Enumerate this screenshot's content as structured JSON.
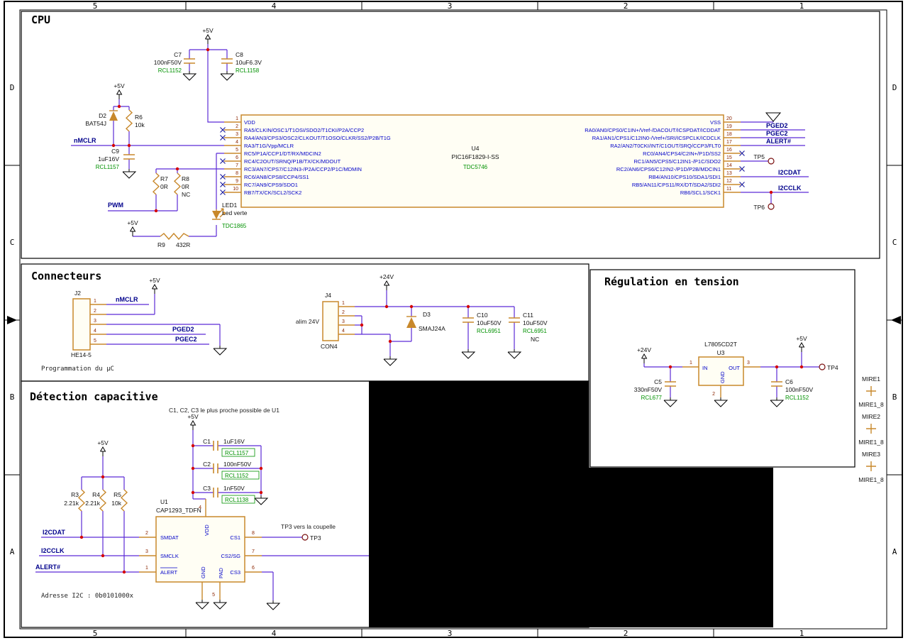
{
  "frame": {
    "columns": [
      "5",
      "4",
      "3",
      "2",
      "1"
    ],
    "rows": [
      "D",
      "C",
      "B",
      "A"
    ]
  },
  "power": {
    "p5v": "+5V",
    "p24v": "+24V"
  },
  "sections": {
    "cpu": {
      "title": "CPU"
    },
    "connecteurs": {
      "title": "Connecteurs"
    },
    "detection": {
      "title": "Détection capacitive"
    },
    "regulation": {
      "title": "Régulation en tension"
    }
  },
  "cpu": {
    "c7": {
      "ref": "C7",
      "value": "100nF50V",
      "code": "RCL1152"
    },
    "c8": {
      "ref": "C8",
      "value": "10uF6.3V",
      "code": "RCL1158"
    },
    "c9": {
      "ref": "C9",
      "value": "1uF16V",
      "code": "RCL1157"
    },
    "d2": {
      "ref": "D2",
      "value": "BAT54J"
    },
    "r6": {
      "ref": "R6",
      "value": "10k"
    },
    "r7": {
      "ref": "R7",
      "value": "0R"
    },
    "r8": {
      "ref": "R8",
      "value": "0R",
      "note": "NC"
    },
    "r9": {
      "ref": "R9",
      "value": "432R"
    },
    "led1": {
      "ref": "LED1",
      "value": "Led verte",
      "code": "TDC1865"
    },
    "u4": {
      "ref": "U4",
      "value": "PIC16F1829-I-SS",
      "code": "TDC5746",
      "left_pins": [
        {
          "num": "1",
          "name": "VDD"
        },
        {
          "num": "2",
          "name": "RA5/CLKIN/OSC1/T1OSI/SDO2/T1CKI/P2A/CCP2"
        },
        {
          "num": "3",
          "name": "RA4/AN3/CPS3/OSC2/CLKOUT/T1OSO/CLKR/SS2/P2B/T1G"
        },
        {
          "num": "4",
          "name": "RA3/T1G/Vpp/MCLR"
        },
        {
          "num": "5",
          "name": "RC5/P1A/CCP1/DT/RX/MDCIN2"
        },
        {
          "num": "6",
          "name": "RC4/C2OUT/SRNQ/P1B/TX/CK/MDOUT"
        },
        {
          "num": "7",
          "name": "RC3/AN7/CPS7/C12IN3-/P2A/CCP2/P1C/MDMIN"
        },
        {
          "num": "8",
          "name": "RC6/AN8/CPS8/CCP4/SS1"
        },
        {
          "num": "9",
          "name": "RC7/AN9/CPS9/SDO1"
        },
        {
          "num": "10",
          "name": "RB7/TX/CK/SCL2/SCK2"
        }
      ],
      "right_pins": [
        {
          "num": "20",
          "name": "VSS"
        },
        {
          "num": "19",
          "name": "RA0/AN0/CPS0/C1IN+/Vref-/DACOUT/ICSPDAT/ICDDAT"
        },
        {
          "num": "18",
          "name": "RA1/AN1/CPS1/C12IN0-/Vref+/SRI/ICSPCLK/ICDCLK"
        },
        {
          "num": "17",
          "name": "RA2/AN2/T0CKI/INT/C1OUT/SRQ/CCP3/FLT0"
        },
        {
          "num": "16",
          "name": "RC0/AN4/CPS4/C2IN+/P1D/SS2"
        },
        {
          "num": "15",
          "name": "RC1/AN5/CPS5/C12IN1-/P1C/SDO2"
        },
        {
          "num": "14",
          "name": "RC2/AN6/CPS6/C12IN2-/P1D/P2B/MDCIN1"
        },
        {
          "num": "13",
          "name": "RB4/AN10/CPS10/SDA1/SDI1"
        },
        {
          "num": "12",
          "name": "RB5/AN11/CPS11/RX/DT/SDA2/SDI2"
        },
        {
          "num": "11",
          "name": "RB6/SCL1/SCK1"
        }
      ]
    },
    "nets": {
      "nmclr": "nMCLR",
      "pwm": "PWM",
      "pged2": "PGED2",
      "pgec2": "PGEC2",
      "alert": "ALERT#",
      "i2cdat": "I2CDAT",
      "i2cclk": "I2CCLK"
    },
    "testpoints": {
      "tp5": "TP5",
      "tp6": "TP6"
    }
  },
  "connecteurs": {
    "j2": {
      "ref": "J2",
      "value": "HE14-5",
      "pins": [
        "1",
        "2",
        "3",
        "4",
        "5"
      ]
    },
    "caption": "Programmation du µC",
    "j4": {
      "ref": "J4",
      "value": "CON4",
      "pins": [
        "1",
        "2",
        "3",
        "4"
      ]
    },
    "alim": "alim 24V",
    "d3": {
      "ref": "D3",
      "value": "SMAJ24A"
    },
    "c10": {
      "ref": "C10",
      "value": "10uF50V",
      "code": "RCL6951"
    },
    "c11": {
      "ref": "C11",
      "value": "10uF50V",
      "code": "RCL6951",
      "note": "NC"
    },
    "nets": {
      "nmclr": "nMCLR",
      "pged2": "PGED2",
      "pgec2": "PGEC2"
    }
  },
  "regulation": {
    "u3": {
      "ref": "U3",
      "value": "L7805CD2T",
      "pin_in": "IN",
      "pin_out": "OUT",
      "pin_gnd": "GND",
      "num_in": "1",
      "num_gnd": "2",
      "num_out": "3"
    },
    "c5": {
      "ref": "C5",
      "value": "330nF50V",
      "code": "RCL677"
    },
    "c6": {
      "ref": "C6",
      "value": "100nF50V",
      "code": "RCL1152"
    },
    "tp4": "TP4",
    "mires": [
      {
        "name": "MIRE1",
        "fp": "MIRE1_8"
      },
      {
        "name": "MIRE2",
        "fp": "MIRE1_8"
      },
      {
        "name": "MIRE3",
        "fp": "MIRE1_8"
      }
    ]
  },
  "detection": {
    "note": "C1, C2, C3 le plus proche possible de U1",
    "c1": {
      "ref": "C1",
      "value": "1uF16V",
      "code": "RCL1157"
    },
    "c2": {
      "ref": "C2",
      "value": "100nF50V",
      "code": "RCL1152"
    },
    "c3": {
      "ref": "C3",
      "value": "1nF50V",
      "code": "RCL1138"
    },
    "r3": {
      "ref": "R3",
      "value": "2.21k"
    },
    "r4": {
      "ref": "R4",
      "value": "2.21k"
    },
    "r5": {
      "ref": "R5",
      "value": "10k"
    },
    "u1": {
      "ref": "U1",
      "value": "CAP1293_TDFN",
      "left_pins": [
        {
          "num": "2",
          "name": "SMDAT"
        },
        {
          "num": "3",
          "name": "SMCLK"
        },
        {
          "num": "1",
          "name": "ALERT"
        }
      ],
      "right_pins": [
        {
          "num": "8",
          "name": "CS1"
        },
        {
          "num": "7",
          "name": "CS2/SG"
        },
        {
          "num": "6",
          "name": "CS3"
        }
      ],
      "top_pins": [
        {
          "num": "4",
          "name": "VDD"
        }
      ],
      "bottom_pins": [
        {
          "num": "",
          "name": "GND"
        },
        {
          "num": "5",
          "name": "PAD"
        }
      ]
    },
    "nets": {
      "i2cdat": "I2CDAT",
      "i2cclk": "I2CCLK",
      "alert": "ALERT#"
    },
    "tp3": "TP3",
    "tp3_note": "TP3 vers la coupelle",
    "addr_note": "Adresse I2C : 0b0101000x"
  }
}
